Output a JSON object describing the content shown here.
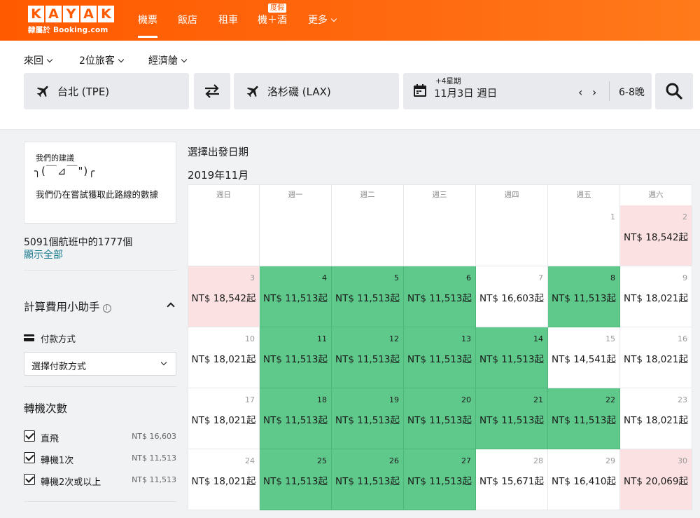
{
  "brand": {
    "letters": [
      "K",
      "A",
      "Y",
      "A",
      "K"
    ],
    "sub": "隸屬於 Booking.com",
    "colors": {
      "orange": "#ff5a00",
      "green": "#5ec98a",
      "pink": "#fbe1e1",
      "link": "#1e7e91"
    }
  },
  "nav": {
    "items": [
      {
        "label": "機票",
        "active": true
      },
      {
        "label": "飯店"
      },
      {
        "label": "租車"
      },
      {
        "label": "機＋酒",
        "badge": "度假"
      },
      {
        "label": "更多"
      }
    ]
  },
  "search": {
    "trip_type": "來回",
    "travelers": "2位旅客",
    "cabin": "經濟艙",
    "origin": "台北 (TPE)",
    "destination": "洛杉磯 (LAX)",
    "flex": "+4星期",
    "date": "11月3日 週日",
    "nights": "6-8晚",
    "icons": [
      "plane-icon",
      "swap-icon",
      "calendar-icon",
      "search-icon"
    ]
  },
  "sidebar": {
    "advice_title": "我們的建議",
    "advice_emoji": "╮(￣⊿￣\")╭",
    "advice_msg": "我們仍在嘗試獲取此路線的數據",
    "count": "5091個航班中的1777個",
    "show_all": "顯示全部",
    "calc_title": "計算費用小助手",
    "pay_label": "付款方式",
    "pay_select": "選擇付款方式",
    "stops_title": "轉機次數",
    "stops": [
      {
        "label": "直飛",
        "price": "NT$ 16,603",
        "checked": true
      },
      {
        "label": "轉機1次",
        "price": "NT$ 11,513",
        "checked": true
      },
      {
        "label": "轉機2次或以上",
        "price": "NT$ 11,513",
        "checked": true
      }
    ]
  },
  "calendar": {
    "heading": "選擇出發日期",
    "month": "2019年11月",
    "weekdays": [
      "週日",
      "週一",
      "週二",
      "週三",
      "週四",
      "週五",
      "週六"
    ],
    "weeks": [
      [
        null,
        null,
        null,
        null,
        null,
        {
          "day": "1",
          "price": "",
          "status": "none"
        },
        {
          "day": "2",
          "price": "NT$ 18,542起",
          "status": "pink"
        }
      ],
      [
        {
          "day": "3",
          "price": "NT$ 18,542起",
          "status": "pink"
        },
        {
          "day": "4",
          "price": "NT$ 11,513起",
          "status": "green"
        },
        {
          "day": "5",
          "price": "NT$ 11,513起",
          "status": "green"
        },
        {
          "day": "6",
          "price": "NT$ 11,513起",
          "status": "green"
        },
        {
          "day": "7",
          "price": "NT$ 16,603起",
          "status": "none"
        },
        {
          "day": "8",
          "price": "NT$ 11,513起",
          "status": "green"
        },
        {
          "day": "9",
          "price": "NT$ 18,021起",
          "status": "none"
        }
      ],
      [
        {
          "day": "10",
          "price": "NT$ 18,021起",
          "status": "none"
        },
        {
          "day": "11",
          "price": "NT$ 11,513起",
          "status": "green"
        },
        {
          "day": "12",
          "price": "NT$ 11,513起",
          "status": "green"
        },
        {
          "day": "13",
          "price": "NT$ 11,513起",
          "status": "green"
        },
        {
          "day": "14",
          "price": "NT$ 11,513起",
          "status": "green"
        },
        {
          "day": "15",
          "price": "NT$ 14,541起",
          "status": "none"
        },
        {
          "day": "16",
          "price": "NT$ 18,021起",
          "status": "none"
        }
      ],
      [
        {
          "day": "17",
          "price": "NT$ 18,021起",
          "status": "none"
        },
        {
          "day": "18",
          "price": "NT$ 11,513起",
          "status": "green"
        },
        {
          "day": "19",
          "price": "NT$ 11,513起",
          "status": "green"
        },
        {
          "day": "20",
          "price": "NT$ 11,513起",
          "status": "green"
        },
        {
          "day": "21",
          "price": "NT$ 11,513起",
          "status": "green"
        },
        {
          "day": "22",
          "price": "NT$ 11,513起",
          "status": "green"
        },
        {
          "day": "23",
          "price": "NT$ 18,021起",
          "status": "none"
        }
      ],
      [
        {
          "day": "24",
          "price": "NT$ 18,021起",
          "status": "none"
        },
        {
          "day": "25",
          "price": "NT$ 11,513起",
          "status": "green"
        },
        {
          "day": "26",
          "price": "NT$ 11,513起",
          "status": "green"
        },
        {
          "day": "27",
          "price": "NT$ 11,513起",
          "status": "green"
        },
        {
          "day": "28",
          "price": "NT$ 15,671起",
          "status": "none"
        },
        {
          "day": "29",
          "price": "NT$ 16,410起",
          "status": "none"
        },
        {
          "day": "30",
          "price": "NT$ 20,069起",
          "status": "pink"
        }
      ]
    ]
  }
}
